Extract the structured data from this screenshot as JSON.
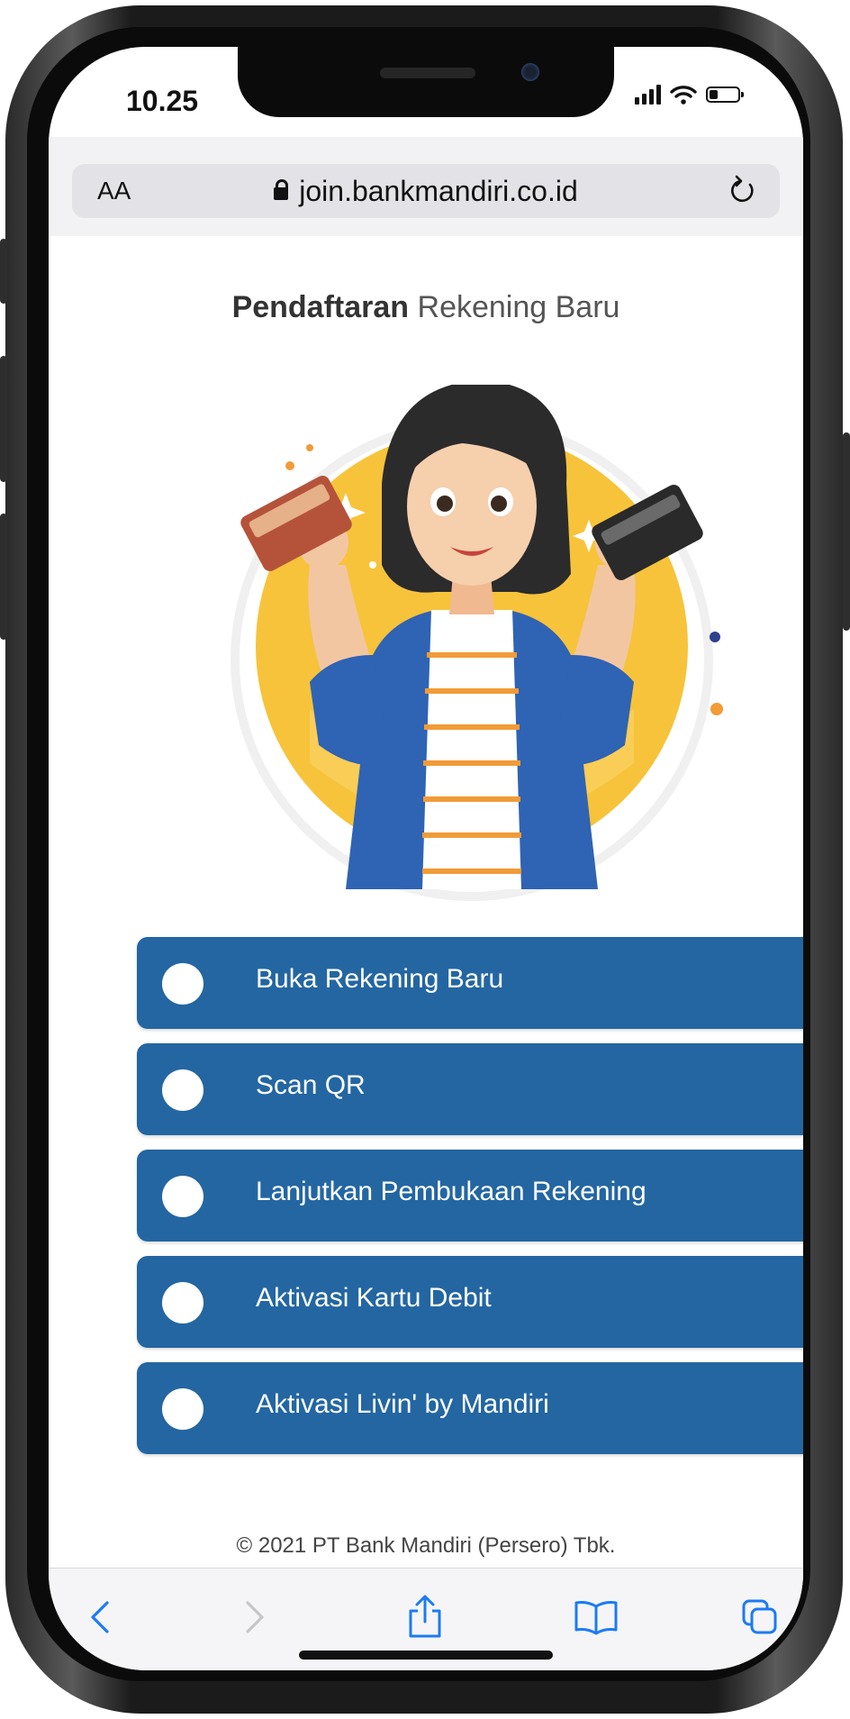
{
  "status_bar": {
    "time": "10.25",
    "battery_level": 0.3
  },
  "browser": {
    "text_size_label": "AA",
    "url": "join.bankmandiri.co.id"
  },
  "page": {
    "title_bold": "Pendaftaran",
    "title_regular": "Rekening Baru",
    "menu_items": [
      {
        "label": "Buka Rekening Baru"
      },
      {
        "label": "Scan QR"
      },
      {
        "label": "Lanjutkan Pembukaan Rekening"
      },
      {
        "label": "Aktivasi Kartu Debit"
      },
      {
        "label": "Aktivasi Livin' by Mandiri"
      }
    ],
    "footer": "© 2021 PT Bank Mandiri (Persero) Tbk."
  },
  "colors": {
    "button_blue": "#2366a2",
    "accent_yellow": "#f7c33a",
    "jacket_blue": "#2f63b4",
    "safari_blue": "#1b7bf5"
  },
  "toolbar_icons": [
    "back-icon",
    "forward-icon",
    "share-icon",
    "bookmarks-icon",
    "tabs-icon"
  ]
}
